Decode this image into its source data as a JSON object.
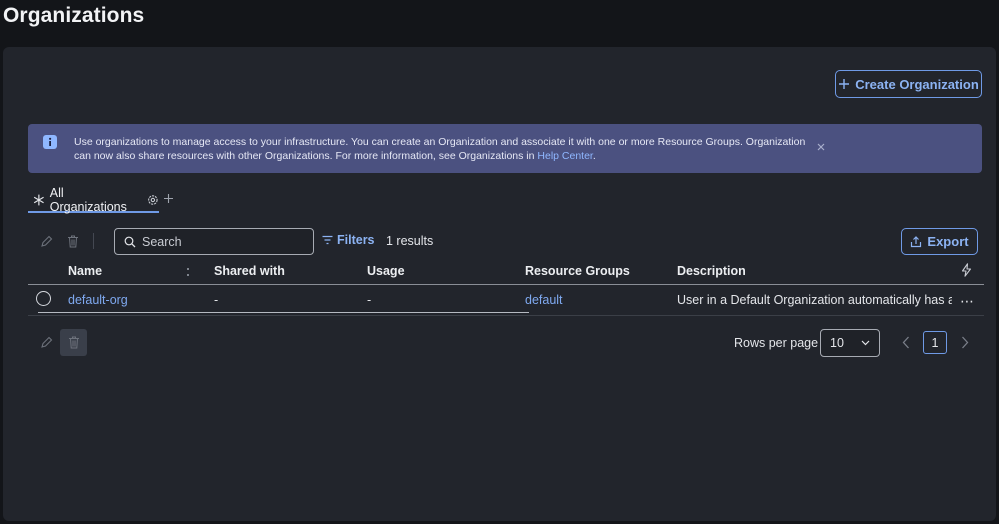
{
  "page": {
    "title": "Organizations"
  },
  "toolbar": {
    "create_label": "Create Organization",
    "export_label": "Export"
  },
  "banner": {
    "text": "Use organizations to manage access to your infrastructure. You can create an Organization and associate it with one or more Resource Groups. Organization can now also share resources with other Organizations. For more information, see Organizations in ",
    "link_text": "Help Center",
    "suffix": "."
  },
  "tabs": {
    "active_label": "All Organizations"
  },
  "search": {
    "placeholder": "Search"
  },
  "filters": {
    "label": "Filters",
    "results": "1 results"
  },
  "table": {
    "columns": [
      "Name",
      "Shared with",
      "Usage",
      "Resource Groups",
      "Description"
    ],
    "rows": [
      {
        "name": "default-org",
        "shared_with": "-",
        "usage": "-",
        "resource_groups": "default",
        "description": "User in a Default Organization automatically has acc"
      }
    ]
  },
  "pagination": {
    "rows_label": "Rows per page",
    "rows_value": "10",
    "current_page": "1"
  },
  "colors": {
    "accent": "#6f9ae6",
    "link": "#7fa9f0",
    "banner_bg": "#4b5180",
    "panel_bg": "#22252c",
    "page_bg": "#131519"
  },
  "icons": [
    "info-icon",
    "close-icon",
    "plus-icon",
    "asterisk-icon",
    "settings-icon",
    "edit-icon",
    "trash-icon",
    "search-icon",
    "filter-icon",
    "export-icon",
    "sort-icon",
    "lightning-icon",
    "kebab-icon",
    "chevron-down-icon",
    "chevron-left-icon",
    "chevron-right-icon"
  ]
}
